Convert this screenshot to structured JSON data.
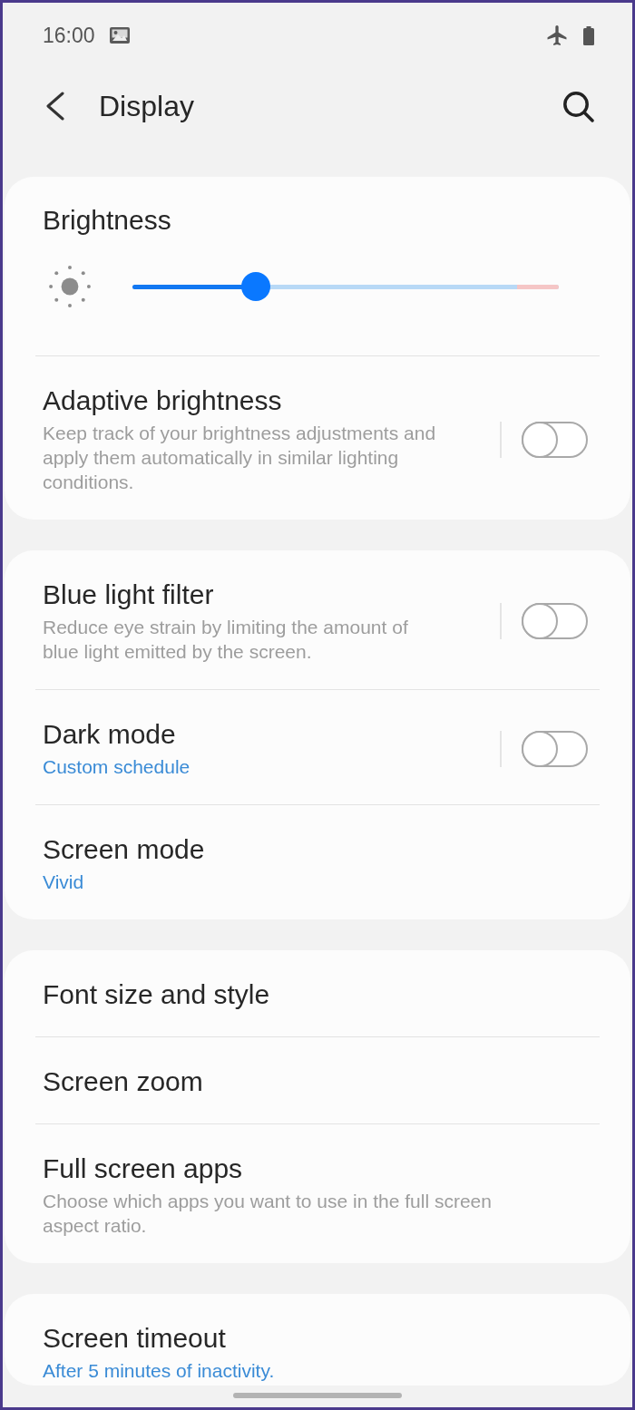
{
  "status_bar": {
    "time": "16:00"
  },
  "header": {
    "title": "Display"
  },
  "cards": [
    {
      "items": [
        {
          "kind": "slider",
          "title": "Brightness",
          "level": 0.29
        },
        {
          "kind": "switch",
          "title": "Adaptive brightness",
          "description": "Keep track of your brightness adjustments and apply them automatically in similar lighting conditions.",
          "on": false
        }
      ]
    },
    {
      "items": [
        {
          "kind": "switch",
          "title": "Blue light filter",
          "description": "Reduce eye strain by limiting the amount of blue light emitted by the screen.",
          "on": false
        },
        {
          "kind": "switch",
          "title": "Dark mode",
          "value": "Custom schedule",
          "on": false
        },
        {
          "kind": "link",
          "title": "Screen mode",
          "value": "Vivid"
        }
      ]
    },
    {
      "items": [
        {
          "kind": "link",
          "title": "Font size and style"
        },
        {
          "kind": "link",
          "title": "Screen zoom"
        },
        {
          "kind": "link",
          "title": "Full screen apps",
          "description": "Choose which apps you want to use in the full screen aspect ratio."
        }
      ]
    },
    {
      "items": [
        {
          "kind": "link",
          "title": "Screen timeout",
          "value": "After 5 minutes of inactivity."
        }
      ]
    }
  ]
}
